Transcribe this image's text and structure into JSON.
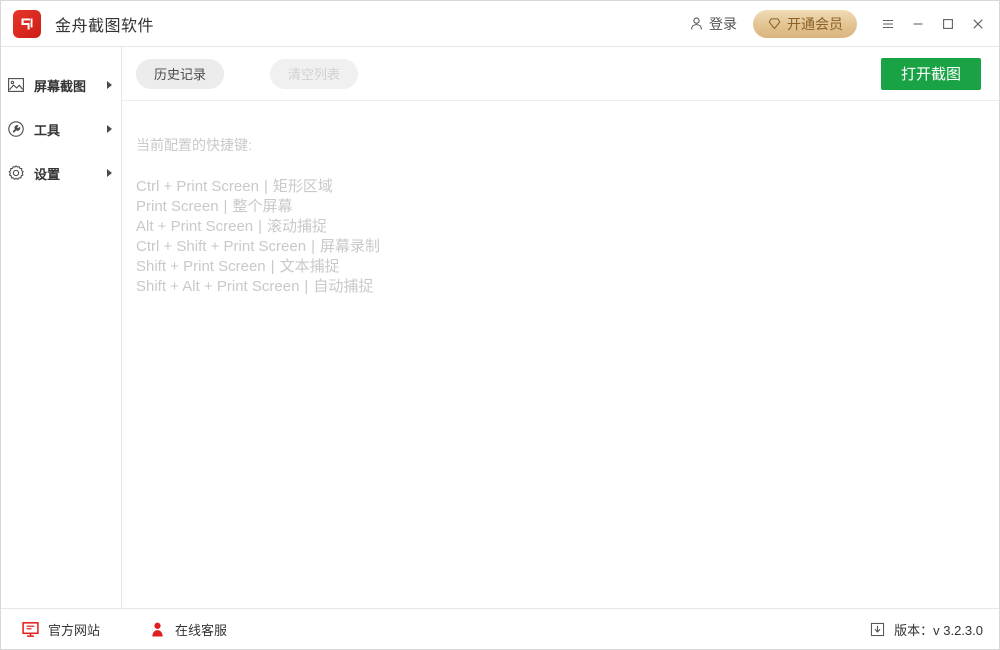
{
  "window": {
    "app_title": "金舟截图软件",
    "logo_color": "#d8241b",
    "controls": {
      "login_label": "登录",
      "login_icon": "user-icon",
      "vip_label": "开通会员",
      "vip_icon": "diamond-icon",
      "vip_color": "#e2c392",
      "menu_icon": "hamburger-menu-icon",
      "minimize_icon": "minimize-icon",
      "maximize_icon": "maximize-icon",
      "close_icon": "close-icon"
    }
  },
  "sidebar": {
    "items": [
      {
        "label": "屏幕截图",
        "icon": "image-capture-icon",
        "arrow": "chevron-right-icon"
      },
      {
        "label": "工具",
        "icon": "wrench-icon",
        "arrow": "chevron-right-icon"
      },
      {
        "label": "设置",
        "icon": "gear-icon",
        "arrow": "chevron-right-icon"
      }
    ]
  },
  "toolbar": {
    "history_label": "历史记录",
    "clear_label": "清空列表",
    "clear_disabled": true,
    "open_label": "打开截图",
    "open_color": "#19a345"
  },
  "content": {
    "hotkeys_title": "当前配置的快捷键:",
    "separator": "|",
    "hotkeys": [
      {
        "keys": "Ctrl + Print Screen",
        "action": "矩形区域"
      },
      {
        "keys": "Print Screen",
        "action": "整个屏幕"
      },
      {
        "keys": "Alt + Print Screen",
        "action": "滚动捕捉"
      },
      {
        "keys": "Ctrl + Shift + Print Screen",
        "action": "屏幕录制"
      },
      {
        "keys": "Shift + Print Screen",
        "action": "文本捕捉"
      },
      {
        "keys": "Shift + Alt + Print Screen",
        "action": "自动捕捉"
      }
    ],
    "text_color": "#c9c9c9"
  },
  "footer": {
    "website_label": "官方网站",
    "website_icon": "monitor-icon",
    "support_label": "在线客服",
    "support_icon": "person-icon",
    "icon_color": "#e02020",
    "version_label": "版本：v 3.2.3.0",
    "version_icon": "download-icon"
  }
}
